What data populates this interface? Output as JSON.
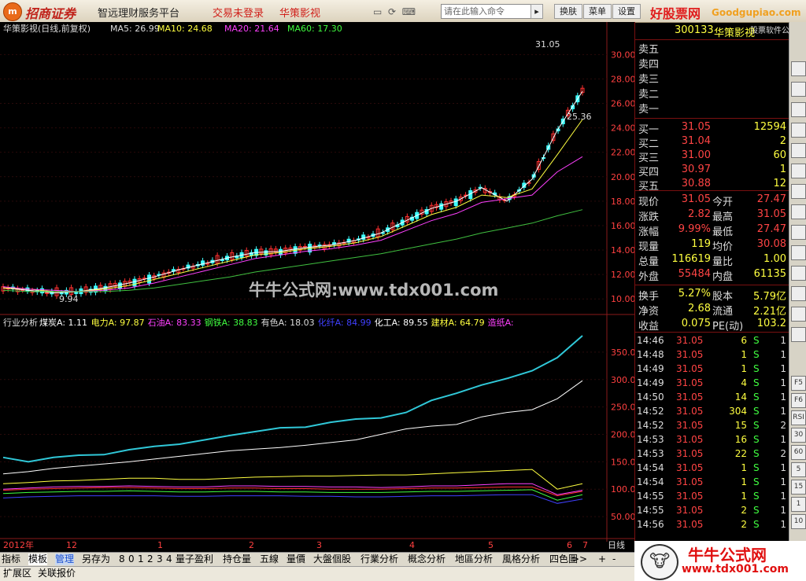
{
  "titlebar": {
    "logo_icon": "zhaoshang-logo-icon",
    "logo_badge": "m",
    "broker": "招商证券",
    "platform": "智远理财服务平台",
    "login_status": "交易未登录",
    "stock_title": "华策影视",
    "search_placeholder": "请在此输入命令",
    "btn_switch": "换肤",
    "btn_menu": "菜单",
    "btn_settings": "设置",
    "brand": "好股票网",
    "brand_url": "Goodgupiao.com",
    "brand_sub": "股票软件公式"
  },
  "kline": {
    "header_name": "华策影视(日线,前复权)",
    "ma5": "MA5: 26.99",
    "ma10": "MA10: 24.68",
    "ma20": "MA20: 21.64",
    "ma60": "MA60: 17.30",
    "high_label": "31.05",
    "mid_label": "25.36",
    "low_label": "9.94",
    "y_ticks": [
      "30.00",
      "28.00",
      "26.00",
      "24.00",
      "22.00",
      "20.00",
      "18.00",
      "16.00",
      "14.00",
      "12.00",
      "10.00"
    ],
    "watermark": "牛牛公式网:www.tdx001.com"
  },
  "industry": {
    "header": "行业分析",
    "items": [
      {
        "name": "煤炭A:",
        "value": "1.11",
        "color": "#ffffff"
      },
      {
        "name": "电力A:",
        "value": "97.87",
        "color": "#ffff40"
      },
      {
        "name": "石油A:",
        "value": "83.33",
        "color": "#ff40ff"
      },
      {
        "name": "钢铁A:",
        "value": "38.83",
        "color": "#40ff40"
      },
      {
        "name": "有色A:",
        "value": "18.03",
        "color": "#dddddd"
      },
      {
        "name": "化纤A:",
        "value": "84.99",
        "color": "#4040ff"
      },
      {
        "name": "化工A:",
        "value": "89.55",
        "color": "#ffffff"
      },
      {
        "name": "建材A:",
        "value": "64.79",
        "color": "#ffff40"
      },
      {
        "name": "造纸A:",
        "value": "",
        "color": "#ff40ff"
      }
    ],
    "y_ticks": [
      "350.00",
      "300.00",
      "250.00",
      "200.00",
      "150.00",
      "100.00",
      "50.00"
    ]
  },
  "x_axis": {
    "labels": [
      "2012年",
      "12",
      "1",
      "2",
      "3",
      "4",
      "5",
      "6",
      "7"
    ],
    "period": "日线"
  },
  "quote": {
    "code": "300133",
    "name": "华策影视",
    "sell": [
      "卖五",
      "卖四",
      "卖三",
      "卖二",
      "卖一"
    ],
    "buy": [
      {
        "label": "买一",
        "price": "31.05",
        "vol": "12594"
      },
      {
        "label": "买二",
        "price": "31.04",
        "vol": "2"
      },
      {
        "label": "买三",
        "price": "31.00",
        "vol": "60"
      },
      {
        "label": "买四",
        "price": "30.97",
        "vol": "1"
      },
      {
        "label": "买五",
        "price": "30.88",
        "vol": "12"
      }
    ],
    "stats": [
      {
        "l1": "现价",
        "v1": "31.05",
        "l2": "今开",
        "v2": "27.47"
      },
      {
        "l1": "涨跌",
        "v1": "2.82",
        "l2": "最高",
        "v2": "31.05"
      },
      {
        "l1": "涨幅",
        "v1": "9.99%",
        "l2": "最低",
        "v2": "27.47"
      },
      {
        "l1": "现量",
        "v1": "119",
        "l2": "均价",
        "v2": "30.08"
      },
      {
        "l1": "总量",
        "v1": "116619",
        "l2": "量比",
        "v2": "1.00"
      },
      {
        "l1": "外盘",
        "v1": "55484",
        "l2": "内盘",
        "v2": "61135"
      }
    ],
    "stats2": [
      {
        "l1": "换手",
        "v1": "5.27%",
        "l2": "股本",
        "v2": "5.79亿"
      },
      {
        "l1": "净资",
        "v1": "2.68",
        "l2": "流通",
        "v2": "2.21亿"
      },
      {
        "l1": "收益",
        "v1": "0.075",
        "l2": "PE(动)",
        "v2": "103.2"
      }
    ],
    "ticks": [
      {
        "t": "14:46",
        "p": "31.05",
        "v": "6",
        "s": "S",
        "n": "1"
      },
      {
        "t": "14:48",
        "p": "31.05",
        "v": "1",
        "s": "S",
        "n": "1"
      },
      {
        "t": "14:49",
        "p": "31.05",
        "v": "1",
        "s": "S",
        "n": "1"
      },
      {
        "t": "14:49",
        "p": "31.05",
        "v": "4",
        "s": "S",
        "n": "1"
      },
      {
        "t": "14:50",
        "p": "31.05",
        "v": "14",
        "s": "S",
        "n": "1"
      },
      {
        "t": "14:52",
        "p": "31.05",
        "v": "304",
        "s": "S",
        "n": "1"
      },
      {
        "t": "14:52",
        "p": "31.05",
        "v": "15",
        "s": "S",
        "n": "2"
      },
      {
        "t": "14:53",
        "p": "31.05",
        "v": "16",
        "s": "S",
        "n": "1"
      },
      {
        "t": "14:53",
        "p": "31.05",
        "v": "22",
        "s": "S",
        "n": "2"
      },
      {
        "t": "14:54",
        "p": "31.05",
        "v": "1",
        "s": "S",
        "n": "1"
      },
      {
        "t": "14:54",
        "p": "31.05",
        "v": "1",
        "s": "S",
        "n": "1"
      },
      {
        "t": "14:55",
        "p": "31.05",
        "v": "1",
        "s": "S",
        "n": "1"
      },
      {
        "t": "14:55",
        "p": "31.05",
        "v": "2",
        "s": "S",
        "n": "1"
      },
      {
        "t": "14:56",
        "p": "31.05",
        "v": "2",
        "s": "S",
        "n": "1"
      }
    ]
  },
  "toolbar_right": [
    "F5",
    "F6",
    "RSI",
    "30",
    "60",
    "5",
    "15",
    "1",
    "10"
  ],
  "bottom_tabs": {
    "items": [
      "指标",
      "模板",
      "管理",
      "另存为",
      "8",
      "0",
      "1",
      "2",
      "3",
      "4",
      "量子盈利",
      "持仓量",
      "五線",
      "量價",
      "大盤個股",
      "行業分析",
      "概念分析",
      "地區分析",
      "風格分析",
      "四色圖"
    ],
    "extra": ">>",
    "plus": "+",
    "minus": "-"
  },
  "bottom_tabs2": [
    "扩展区",
    "关联报价"
  ],
  "ads": {
    "text": "牛牛公式网",
    "url": "www.tdx001.com"
  },
  "chart_data": [
    {
      "type": "line",
      "title": "华策影视(日线,前复权)",
      "ylim": [
        9.5,
        31.5
      ],
      "series": [
        {
          "name": "MA5",
          "color": "#ffffff",
          "values": [
            10.9,
            10.7,
            10.5,
            10.6,
            10.9,
            11.3,
            11.8,
            12.4,
            12.9,
            13.4,
            13.8,
            13.9,
            14.2,
            14.4,
            14.8,
            15.4,
            16.4,
            17.4,
            18.0,
            19.1,
            18.0,
            19.8,
            23.8,
            26.99
          ]
        },
        {
          "name": "MA10",
          "color": "#ffff40",
          "values": [
            10.9,
            10.8,
            10.6,
            10.6,
            10.8,
            11.1,
            11.6,
            12.1,
            12.6,
            13.1,
            13.6,
            13.8,
            14.1,
            14.3,
            14.6,
            15.1,
            16.0,
            16.9,
            17.5,
            18.5,
            18.3,
            19.0,
            21.8,
            24.68
          ]
        },
        {
          "name": "MA20",
          "color": "#ff40ff",
          "values": [
            11.0,
            10.8,
            10.7,
            10.6,
            10.7,
            10.9,
            11.3,
            11.8,
            12.3,
            12.8,
            13.3,
            13.6,
            13.9,
            14.1,
            14.4,
            14.8,
            15.6,
            16.4,
            17.0,
            17.9,
            18.2,
            18.5,
            20.4,
            21.64
          ]
        },
        {
          "name": "MA60",
          "color": "#40c040",
          "values": [
            10.7,
            10.6,
            10.6,
            10.6,
            10.6,
            10.7,
            10.9,
            11.2,
            11.5,
            11.8,
            12.2,
            12.5,
            12.8,
            13.1,
            13.4,
            13.7,
            14.1,
            14.5,
            14.9,
            15.4,
            15.8,
            16.2,
            16.8,
            17.3
          ]
        }
      ]
    },
    {
      "type": "line",
      "title": "行业分析",
      "ylim": [
        20,
        390
      ],
      "series": [
        {
          "name": "造纸A",
          "color": "#30c8d8",
          "values": [
            158,
            150,
            158,
            162,
            163,
            172,
            178,
            182,
            190,
            198,
            205,
            212,
            213,
            222,
            228,
            230,
            240,
            262,
            275,
            290,
            302,
            316,
            340,
            380
          ]
        },
        {
          "name": "化工A",
          "color": "#ffffff",
          "values": [
            128,
            132,
            138,
            142,
            146,
            150,
            155,
            160,
            165,
            170,
            173,
            176,
            180,
            185,
            190,
            200,
            210,
            215,
            218,
            232,
            240,
            245,
            265,
            298
          ]
        },
        {
          "name": "建材A",
          "color": "#ffff40",
          "values": [
            110,
            112,
            115,
            116,
            118,
            120,
            120,
            118,
            118,
            120,
            122,
            123,
            124,
            124,
            125,
            126,
            126,
            128,
            130,
            132,
            134,
            136,
            100,
            110
          ]
        },
        {
          "name": "石油A",
          "color": "#ff40ff",
          "values": [
            100,
            102,
            104,
            105,
            105,
            106,
            105,
            104,
            104,
            106,
            106,
            105,
            105,
            104,
            104,
            103,
            104,
            106,
            106,
            108,
            110,
            110,
            90,
            98
          ]
        },
        {
          "name": "钢铁A",
          "color": "#40ff40",
          "values": [
            92,
            94,
            95,
            96,
            96,
            97,
            96,
            95,
            95,
            96,
            96,
            95,
            95,
            94,
            94,
            94,
            95,
            96,
            96,
            97,
            98,
            99,
            80,
            90
          ]
        },
        {
          "name": "化纤A",
          "color": "#4040ff",
          "values": [
            84,
            86,
            87,
            88,
            88,
            88,
            88,
            87,
            87,
            88,
            88,
            88,
            87,
            87,
            86,
            86,
            87,
            88,
            88,
            89,
            90,
            90,
            74,
            82
          ]
        },
        {
          "name": "电力A",
          "color": "#ff3030",
          "values": [
            98,
            100,
            101,
            102,
            103,
            103,
            102,
            101,
            101,
            102,
            102,
            101,
            101,
            100,
            100,
            100,
            101,
            102,
            102,
            103,
            104,
            104,
            88,
            96
          ]
        }
      ]
    }
  ]
}
